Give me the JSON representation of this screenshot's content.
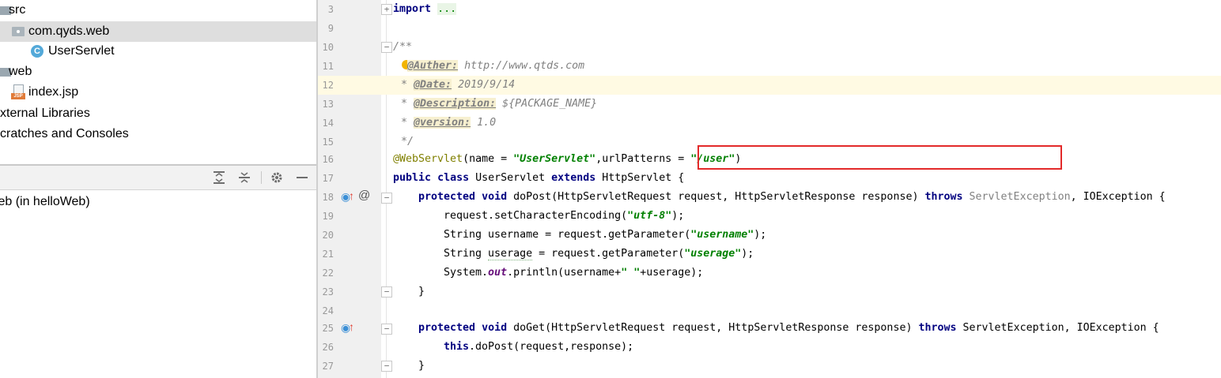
{
  "project_tree": {
    "items": [
      {
        "label": "src",
        "icon": "folder-icon"
      },
      {
        "label": "com.qyds.web",
        "icon": "package-icon",
        "selected": true
      },
      {
        "label": "UserServlet",
        "icon": "class-icon"
      },
      {
        "label": "web",
        "icon": "folder-icon"
      },
      {
        "label": "index.jsp",
        "icon": "jsp-file-icon"
      },
      {
        "label": "xternal Libraries"
      },
      {
        "label": "cratches and Consoles"
      }
    ]
  },
  "run_panel": {
    "item": "/eb (in helloWeb)",
    "toolbar_icons": [
      "expand-all-icon",
      "collapse-all-icon",
      "settings-icon",
      "minimize-icon"
    ]
  },
  "editor": {
    "lines": [
      {
        "n": "3"
      },
      {
        "n": "9"
      },
      {
        "n": "10"
      },
      {
        "n": "11"
      },
      {
        "n": "12"
      },
      {
        "n": "13"
      },
      {
        "n": "14"
      },
      {
        "n": "15"
      },
      {
        "n": "16"
      },
      {
        "n": "17"
      },
      {
        "n": "18"
      },
      {
        "n": "19"
      },
      {
        "n": "20"
      },
      {
        "n": "21"
      },
      {
        "n": "22"
      },
      {
        "n": "23"
      },
      {
        "n": "24"
      },
      {
        "n": "25"
      },
      {
        "n": "26"
      },
      {
        "n": "27"
      }
    ],
    "code": {
      "import_kw": "import",
      "import_dots": "...",
      "doc_open": "/**",
      "auther_tag": "@Auther:",
      "auther_val": " http://www.qtds.com",
      "date_tag": "@Date:",
      "date_val": " 2019/9/14",
      "desc_tag": "@Description:",
      "desc_val": " ${PACKAGE_NAME}",
      "version_tag": "@version:",
      "version_val": " 1.0",
      "doc_close": "*/",
      "webservlet": "@WebServlet",
      "ws_open": "(name = ",
      "ws_name": "\"UserServlet\"",
      "ws_mid": ",urlPatterns = ",
      "ws_url": "\"/user\"",
      "ws_close": ")",
      "l17_public": "public",
      "l17_class": "class",
      "l17_name": " UserServlet ",
      "l17_extends": "extends",
      "l17_rest": " HttpServlet {",
      "l18_protected": "protected",
      "l18_void": "void",
      "l18_sig": " doPost(HttpServletRequest request, HttpServletResponse response) ",
      "l18_throws": "throws",
      "l18_ex1": " ServletException",
      "l18_rest": ", IOException {",
      "l19_a": "request.setCharacterEncoding(",
      "l19_str": "\"utf-8\"",
      "l19_b": ");",
      "l20_a": "String username = request.getParameter(",
      "l20_str": "\"username\"",
      "l20_b": ");",
      "l21_a": "String ",
      "l21_var": "userage",
      "l21_b": " = request.getParameter(",
      "l21_str": "\"userage\"",
      "l21_c": ");",
      "l22_a": "System.",
      "l22_out": "out",
      "l22_b": ".println(username+",
      "l22_str": "\" \"",
      "l22_c": "+userage);",
      "brace": "}",
      "l25_protected": "protected",
      "l25_void": "void",
      "l25_sig": " doGet(HttpServletRequest request, HttpServletResponse response) ",
      "l25_throws": "throws",
      "l25_rest": " ServletException, IOException {",
      "l26_this": "this",
      "l26_rest": ".doPost(request,response);"
    }
  },
  "colors": {
    "keyword": "#000080",
    "string": "#008000",
    "annotation": "#808000",
    "comment": "#808080",
    "highlight_box": "#e32a2a",
    "caret_line": "#fffae3"
  }
}
